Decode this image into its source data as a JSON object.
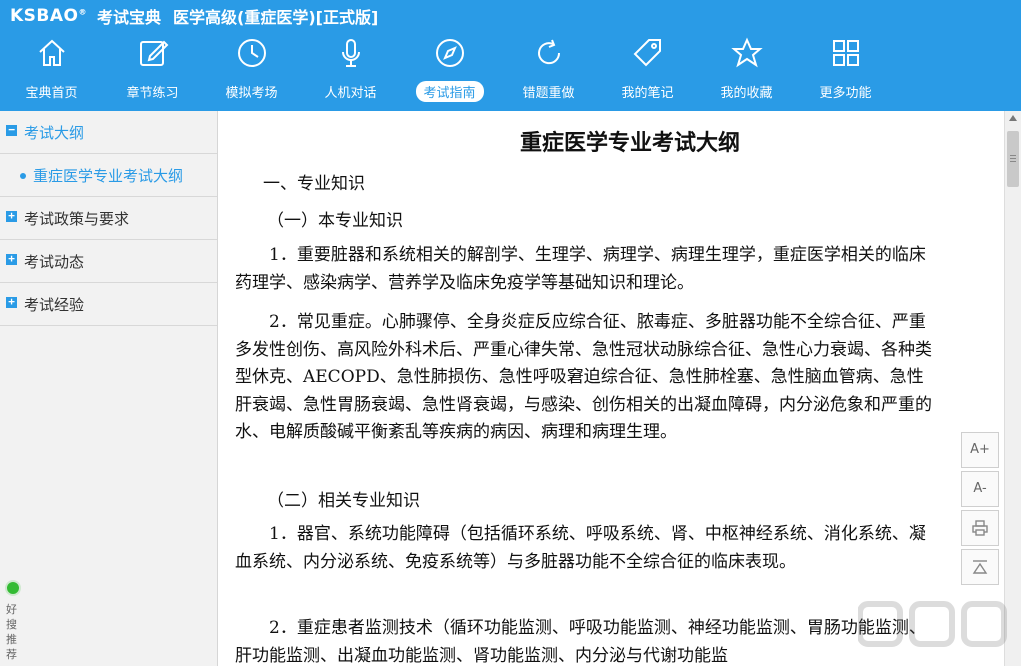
{
  "header": {
    "logo": "KSBAO",
    "logo_mark": "®",
    "app_name": "考试宝典",
    "edition_title": "医学高级(重症医学)[正式版]",
    "bg_color": "#2a9be6"
  },
  "nav": [
    {
      "label": "宝典首页",
      "icon": "home-icon"
    },
    {
      "label": "章节练习",
      "icon": "edit-icon"
    },
    {
      "label": "模拟考场",
      "icon": "clock-icon"
    },
    {
      "label": "人机对话",
      "icon": "microphone-icon"
    },
    {
      "label": "考试指南",
      "icon": "compass-icon",
      "active": true
    },
    {
      "label": "错题重做",
      "icon": "refresh-icon"
    },
    {
      "label": "我的笔记",
      "icon": "tag-icon"
    },
    {
      "label": "我的收藏",
      "icon": "star-icon"
    },
    {
      "label": "更多功能",
      "icon": "grid-icon"
    }
  ],
  "sidebar": {
    "items": [
      {
        "label": "考试大纲",
        "toggle": "−",
        "open": true
      },
      {
        "label": "重症医学专业考试大纲"
      },
      {
        "label": "考试政策与要求",
        "toggle": "+"
      },
      {
        "label": "考试动态",
        "toggle": "+"
      },
      {
        "label": "考试经验",
        "toggle": "+"
      }
    ],
    "recommend_text": "好搜推荐"
  },
  "document": {
    "title": "重症医学专业考试大纲",
    "section1": "一、专业知识",
    "sub1": "（一）本专业知识",
    "p1": "1．重要脏器和系统相关的解剖学、生理学、病理学、病理生理学，重症医学相关的临床药理学、感染病学、营养学及临床免疫学等基础知识和理论。",
    "p2": "2．常见重症。心肺骤停、全身炎症反应综合征、脓毒症、多脏器功能不全综合征、严重多发性创伤、高风险外科术后、严重心律失常、急性冠状动脉综合征、急性心力衰竭、各种类型休克、AECOPD、急性肺损伤、急性呼吸窘迫综合征、急性肺栓塞、急性脑血管病、急性肝衰竭、急性胃肠衰竭、急性肾衰竭，与感染、创伤相关的出凝血障碍，内分泌危象和严重的水、电解质酸碱平衡紊乱等疾病的病因、病理和病理生理。",
    "sub2": "（二）相关专业知识",
    "p3": "1．器官、系统功能障碍（包括循环系统、呼吸系统、肾、中枢神经系统、消化系统、凝血系统、内分泌系统、免疫系统等）与多脏器功能不全综合征的临床表现。",
    "p4": "2．重症患者监测技术（循环功能监测、呼吸功能监测、神经功能监测、胃肠功能监测、肝功能监测、出凝血功能监测、肾功能监测、内分泌与代谢功能监"
  },
  "tools": {
    "font_increase": "A+",
    "font_decrease": "A-",
    "print_icon": "printer-icon",
    "top_icon": "back-to-top-icon"
  }
}
